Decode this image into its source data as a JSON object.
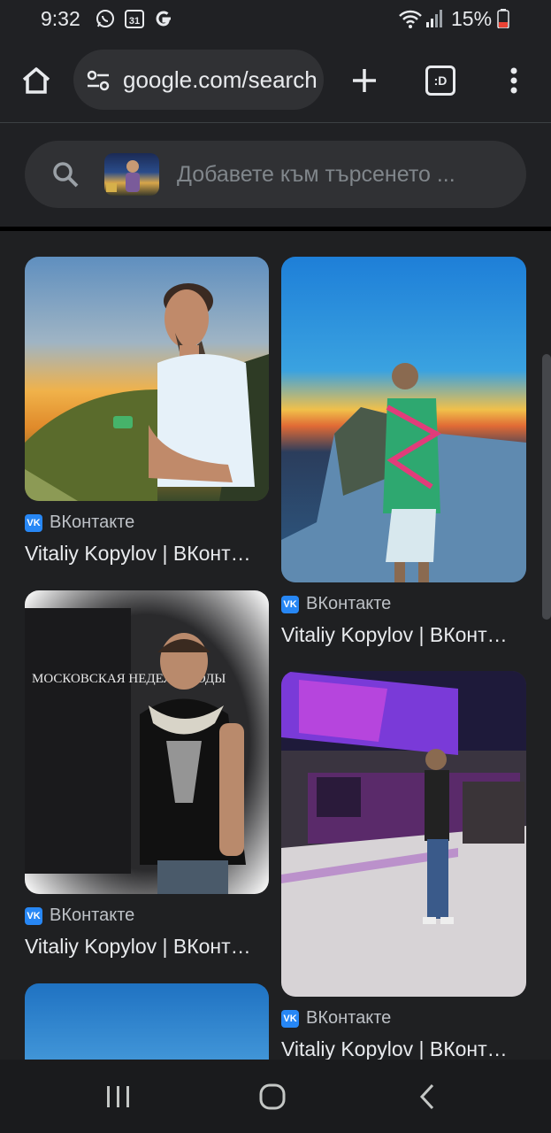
{
  "status_bar": {
    "time": "9:32",
    "calendar_date": "31",
    "battery": "15%",
    "icons": [
      "whatsapp-icon",
      "calendar-icon",
      "google-icon",
      "wifi-icon",
      "signal-icon",
      "battery-icon"
    ]
  },
  "toolbar": {
    "url": "google.com/search",
    "tab_count": ":D",
    "icons": [
      "home-icon",
      "site-settings-icon",
      "new-tab-icon",
      "tab-switcher-icon",
      "more-menu-icon"
    ]
  },
  "search": {
    "placeholder": "Добавете към търсенето ..."
  },
  "results": [
    {
      "source": "ВКонтакте",
      "title": "Vitaliy Kopylov | ВКонт…"
    },
    {
      "source": "ВКонтакте",
      "title": "Vitaliy Kopylov | ВКонт…"
    },
    {
      "source": "ВКонтакте",
      "title": "Vitaliy Kopylov | ВКонт…"
    },
    {
      "source": "ВКонтакте",
      "title": "Vitaliy Kopylov | ВКонт…"
    }
  ],
  "image_texts": {
    "fashion_week_poster": "МОСКОВСКАЯ НЕДЕЛЯ МОДЫ"
  },
  "colors": {
    "background": "#1f2022",
    "toolbar": "#202124",
    "omnibox": "#303134",
    "vk_brand": "#2787f5",
    "text_primary": "#e8eaed",
    "text_secondary": "#bdc1c6"
  }
}
